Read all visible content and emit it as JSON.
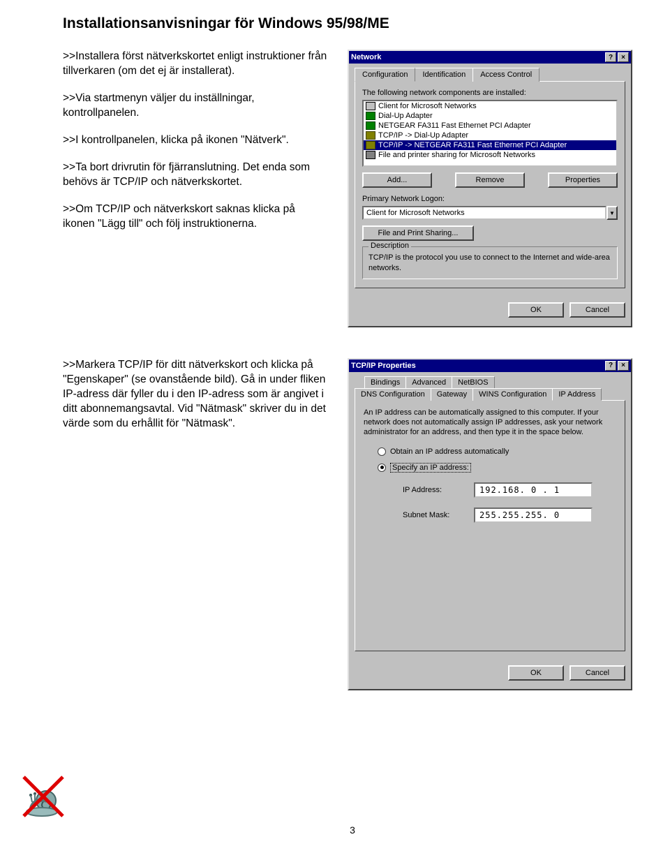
{
  "title": "Installationsanvisningar för Windows 95/98/ME",
  "section1": {
    "p1": ">>Installera först nätverkskortet enligt instruktioner från tillverkaren (om det ej är installerat).",
    "p2": ">>Via startmenyn väljer du inställningar, kontrollpanelen.",
    "p3": ">>I kontrollpanelen, klicka på ikonen \"Nätverk\".",
    "p4": ">>Ta bort drivrutin för fjärranslutning. Det enda som behövs är TCP/IP och nätverkskortet.",
    "p5": ">>Om TCP/IP och nätverkskort saknas klicka på ikonen \"Lägg till\" och följ instruktionerna."
  },
  "section2": {
    "p1": ">>Markera TCP/IP för ditt nätverkskort och klicka på \"Egenskaper\" (se ovanstående bild). Gå in under fliken IP-adress där fyller du i den IP-adress som är angivet i ditt abonnemangsavtal. Vid \"Nätmask\" skriver du in det värde som du erhållit för \"Nätmask\"."
  },
  "network_dialog": {
    "title": "Network",
    "help_btn": "?",
    "close_btn": "×",
    "tabs": [
      "Configuration",
      "Identification",
      "Access Control"
    ],
    "active_tab": 0,
    "installed_label": "The following network components are installed:",
    "items": [
      {
        "icon": "client",
        "text": "Client for Microsoft Networks"
      },
      {
        "icon": "adapter",
        "text": "Dial-Up Adapter"
      },
      {
        "icon": "adapter",
        "text": "NETGEAR FA311 Fast Ethernet PCI Adapter"
      },
      {
        "icon": "proto",
        "text": "TCP/IP -> Dial-Up Adapter"
      },
      {
        "icon": "proto",
        "text": "TCP/IP -> NETGEAR FA311 Fast Ethernet PCI Adapter",
        "selected": true
      },
      {
        "icon": "service",
        "text": "File and printer sharing for Microsoft Networks"
      }
    ],
    "add_btn": "Add...",
    "remove_btn": "Remove",
    "props_btn": "Properties",
    "logon_label": "Primary Network Logon:",
    "logon_value": "Client for Microsoft Networks",
    "fps_btn": "File and Print Sharing...",
    "desc_label": "Description",
    "desc_text": "TCP/IP is the protocol you use to connect to the Internet and wide-area networks.",
    "ok": "OK",
    "cancel": "Cancel"
  },
  "tcpip_dialog": {
    "title": "TCP/IP Properties",
    "help_btn": "?",
    "close_btn": "×",
    "tabs_row1": [
      "Bindings",
      "Advanced",
      "NetBIOS"
    ],
    "tabs_row2": [
      "DNS Configuration",
      "Gateway",
      "WINS Configuration",
      "IP Address"
    ],
    "active_tab": "IP Address",
    "explain": "An IP address can be automatically assigned to this computer. If your network does not automatically assign IP addresses, ask your network administrator for an address, and then type it in the space below.",
    "radio_auto": "Obtain an IP address automatically",
    "radio_specify": "Specify an IP address:",
    "ip_label": "IP Address:",
    "ip_value": "192.168. 0 . 1",
    "mask_label": "Subnet Mask:",
    "mask_value": "255.255.255. 0",
    "ok": "OK",
    "cancel": "Cancel"
  },
  "page_number": "3"
}
